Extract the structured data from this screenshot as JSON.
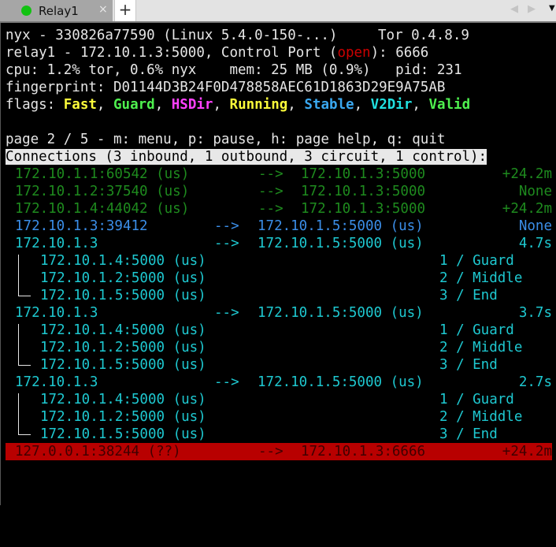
{
  "tabbar": {
    "tab_title": "Relay1",
    "tab_status_color": "#12c212",
    "close_glyph": "×",
    "new_tab_glyph": "+",
    "nav_left_glyph": "◀",
    "nav_right_glyph": "▶",
    "menu_glyph": "▼"
  },
  "header": {
    "line1_left": "nyx - 330826a77590 (Linux 5.4.0-150-...)",
    "line1_right": "Tor 0.4.8.9",
    "line2_prefix": "relay1 - 172.10.1.3:5000, Control Port (",
    "line2_status": "open",
    "line2_suffix": "): 6666",
    "line3": "cpu: 1.2% tor, 0.6% nyx    mem: 25 MB (0.9%)   pid: 231",
    "line4": "fingerprint: D01144D3B24F0D478858AEC61D1863D29E9A75AB",
    "flags_label": "flags: ",
    "flags": [
      "Fast",
      "Guard",
      "HSDir",
      "Running",
      "Stable",
      "V2Dir",
      "Valid"
    ],
    "flag_separator": ", "
  },
  "pager": {
    "text": "page 2 / 5 - m: menu, p: pause, h: page help, q: quit"
  },
  "connections": {
    "title": "Connections (3 inbound, 1 outbound, 3 circuit, 1 control):",
    "arrow": "-->",
    "inbound": [
      {
        "src": "172.10.1.1:60542 (us)",
        "dst": "172.10.1.3:5000",
        "time": "+24.2m"
      },
      {
        "src": "172.10.1.2:37540 (us)",
        "dst": "172.10.1.3:5000",
        "time": "None"
      },
      {
        "src": "172.10.1.4:44042 (us)",
        "dst": "172.10.1.3:5000",
        "time": "+24.2m"
      }
    ],
    "outbound": [
      {
        "src": "172.10.1.3:39412",
        "dst": "172.10.1.5:5000 (us)",
        "time": "None"
      }
    ],
    "circuits": [
      {
        "src": "172.10.1.3",
        "dst": "172.10.1.5:5000 (us)",
        "time": "4.7s",
        "hops": [
          {
            "addr": "172.10.1.4:5000 (us)",
            "role": "1 / Guard"
          },
          {
            "addr": "172.10.1.2:5000 (us)",
            "role": "2 / Middle"
          },
          {
            "addr": "172.10.1.5:5000 (us)",
            "role": "3 / End"
          }
        ]
      },
      {
        "src": "172.10.1.3",
        "dst": "172.10.1.5:5000 (us)",
        "time": "3.7s",
        "hops": [
          {
            "addr": "172.10.1.4:5000 (us)",
            "role": "1 / Guard"
          },
          {
            "addr": "172.10.1.2:5000 (us)",
            "role": "2 / Middle"
          },
          {
            "addr": "172.10.1.5:5000 (us)",
            "role": "3 / End"
          }
        ]
      },
      {
        "src": "172.10.1.3",
        "dst": "172.10.1.5:5000 (us)",
        "time": "2.7s",
        "hops": [
          {
            "addr": "172.10.1.4:5000 (us)",
            "role": "1 / Guard"
          },
          {
            "addr": "172.10.1.2:5000 (us)",
            "role": "2 / Middle"
          },
          {
            "addr": "172.10.1.5:5000 (us)",
            "role": "3 / End"
          }
        ]
      }
    ],
    "control": [
      {
        "src": "127.0.0.1:38244 (??)",
        "dst": "172.10.1.3:6666",
        "time": "+24.2m"
      }
    ]
  },
  "colors": {
    "inbound": "#1e8a1e",
    "outbound": "#3b8ee8",
    "circuit": "#1ec8d0",
    "control_bg": "#b80000",
    "port_open": "#cc0000"
  }
}
